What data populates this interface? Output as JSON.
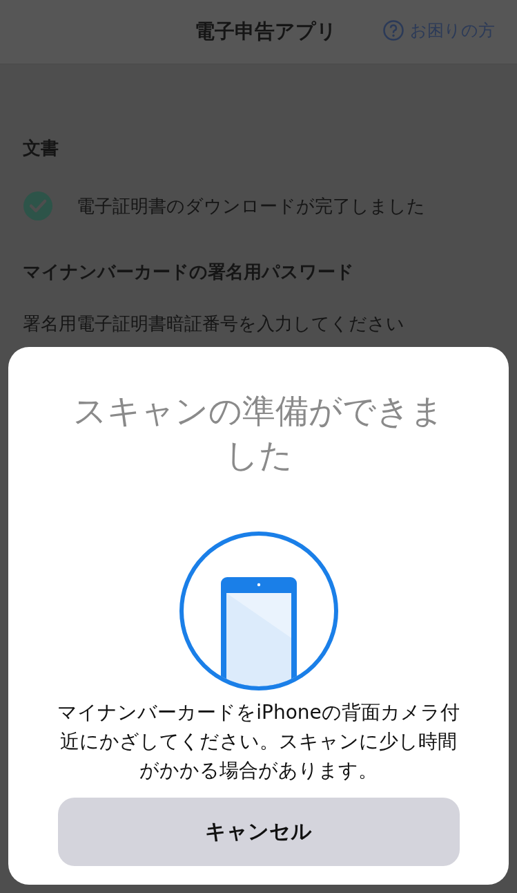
{
  "header": {
    "title": "電子申告アプリ",
    "help_link": "お困りの方"
  },
  "content": {
    "document_heading": "文書",
    "status": {
      "text": "電子証明書のダウンロードが完了しました",
      "done": true
    },
    "password_heading": "マイナンバーカードの署名用パスワード",
    "password_instruction": "署名用電子証明書暗証番号を入力してください"
  },
  "scan_sheet": {
    "title": "スキャンの準備ができました",
    "message": "マイナンバーカードをiPhoneの背面カメラ付近にかざしてください。スキャンに少し時間がかかる場合があります。",
    "cancel_button": "キャンセル"
  }
}
